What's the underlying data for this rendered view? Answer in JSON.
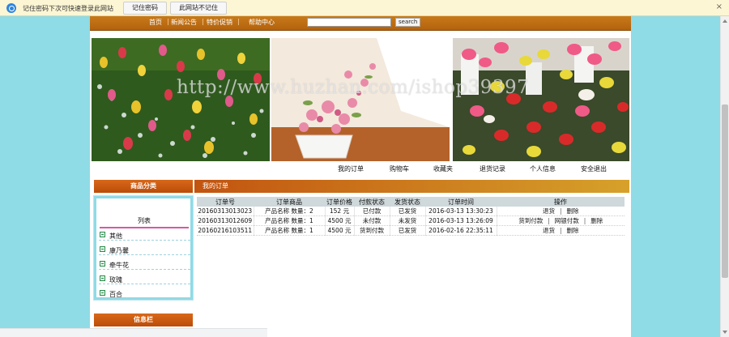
{
  "password_bar": {
    "message": "记住密码下次可快速登录此网站",
    "remember_button": "记住密码",
    "never_button": "此网站不记住",
    "close_glyph": "×"
  },
  "top_nav": {
    "links": [
      "首页",
      "新闻公告",
      "特价促销",
      "帮助中心"
    ],
    "search_value": "",
    "search_button": "search"
  },
  "watermark": "http://www.huzhan.com/ishop39397",
  "user_nav": [
    "我的订单",
    "购物车",
    "收藏夹",
    "退货记录",
    "个人信息",
    "安全退出"
  ],
  "sidebar": {
    "header": "商品分类",
    "list_title": "列表",
    "categories": [
      "其他",
      "康乃馨",
      "牵牛花",
      "玫瑰",
      "百合"
    ],
    "info_header": "信息栏"
  },
  "orders": {
    "header": "我的订单",
    "columns": [
      "订单号",
      "订单商品",
      "订单价格",
      "付款状态",
      "发货状态",
      "订单时间",
      "操作"
    ],
    "rows": [
      {
        "id": "20160313013023",
        "product": "产品名称",
        "qty": "数量：2",
        "price": "152 元",
        "pay_status": "已付款",
        "ship_status": "已发货",
        "time": "2016-03-13 13:30:23",
        "ops": [
          "退货",
          "删除"
        ]
      },
      {
        "id": "20160313012609",
        "product": "产品名称",
        "qty": "数量：1",
        "price": "4500 元",
        "pay_status": "未付款",
        "ship_status": "未发货",
        "time": "2016-03-13 13:26:09",
        "ops": [
          "货到付款",
          "网银付款",
          "删除"
        ]
      },
      {
        "id": "20160216103511",
        "product": "产品名称",
        "qty": "数量：1",
        "price": "4500 元",
        "pay_status": "货到付款",
        "ship_status": "已发货",
        "time": "2016-02-16 22:35:11",
        "ops": [
          "退货",
          "删除"
        ]
      }
    ]
  },
  "colors": {
    "page_bg": "#8fdbe6",
    "nav_orange": "#b3620c",
    "header_orange": "#bb4c08",
    "list_underline": "#d35aa3"
  }
}
